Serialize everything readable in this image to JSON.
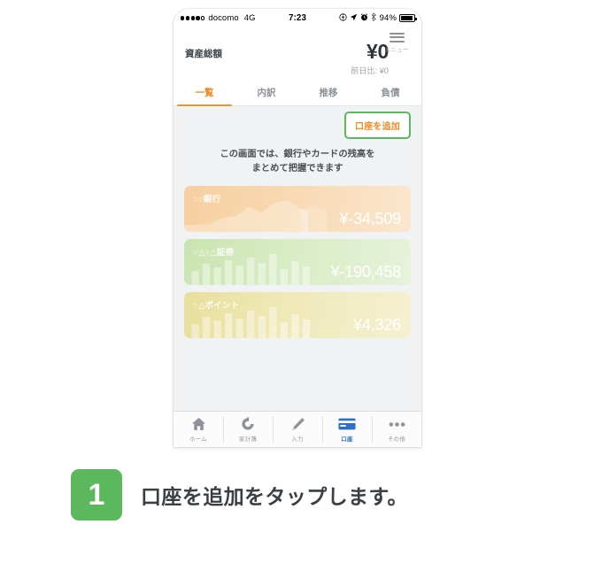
{
  "statusbar": {
    "signal_dots": [
      true,
      true,
      true,
      true,
      false
    ],
    "carrier": "docomo",
    "network": "4G",
    "time": "7:23",
    "icons": [
      "target-icon",
      "location-arrow-icon",
      "alarm-clock-icon",
      "bluetooth-icon"
    ],
    "battery_percent": "94%"
  },
  "navbar": {
    "menu_label": "メニュー",
    "menu_icon": "hamburger-icon"
  },
  "header": {
    "asset_label": "資産総額",
    "asset_total": "¥0",
    "asset_delta": "前日比: ¥0"
  },
  "tabs": [
    {
      "label": "一覧",
      "active": true
    },
    {
      "label": "内訳",
      "active": false
    },
    {
      "label": "推移",
      "active": false
    },
    {
      "label": "負債",
      "active": false
    }
  ],
  "content": {
    "add_account_label": "口座を追加",
    "description_line1": "この画面では、銀行やカードの残高を",
    "description_line2": "まとめて把握できます"
  },
  "accounts": [
    {
      "name": "○○銀行",
      "amount": "¥-34,509",
      "chart_type": "area",
      "color_from": "#f7d2a4",
      "color_to": "#fbe3c7"
    },
    {
      "name": "○△○△証券",
      "amount": "¥-190,458",
      "chart_type": "bar",
      "color_from": "#cfe7b8",
      "color_to": "#e4f0d5"
    },
    {
      "name": "○△ポイント",
      "amount": "¥4,326",
      "chart_type": "bar",
      "color_from": "#ece3a8",
      "color_to": "#f3eec6"
    }
  ],
  "tabbar": [
    {
      "label": "ホーム",
      "icon": "home-icon",
      "active": false
    },
    {
      "label": "家計簿",
      "icon": "refresh-circle-icon",
      "active": false
    },
    {
      "label": "入力",
      "icon": "pencil-icon",
      "active": false
    },
    {
      "label": "口座",
      "icon": "credit-card-icon",
      "active": true
    },
    {
      "label": "その他",
      "icon": "ellipsis-icon",
      "active": false
    }
  ],
  "step": {
    "number": "1",
    "text": "口座を追加をタップします。"
  },
  "colors": {
    "accent_orange": "#f08a23",
    "highlight_green": "#5cb85c",
    "active_blue": "#2f6fc4",
    "content_bg": "#f1f2f3"
  },
  "chart_data": {
    "type": "area",
    "title": "",
    "series": [
      {
        "name": "○○銀行",
        "type": "area",
        "values": [
          8,
          8,
          9,
          20,
          22,
          34,
          26,
          40,
          44,
          30,
          27,
          36,
          34
        ]
      },
      {
        "name": "○△○△証券",
        "type": "bar",
        "values": [
          14,
          22,
          18,
          26,
          20,
          30,
          24,
          34,
          16,
          28,
          22
        ]
      },
      {
        "name": "○△ポイント",
        "type": "bar",
        "values": [
          14,
          22,
          18,
          26,
          20,
          30,
          24,
          34,
          16,
          28,
          22
        ]
      }
    ],
    "xlabel": "",
    "ylabel": "",
    "grid": false,
    "legend": "none"
  }
}
